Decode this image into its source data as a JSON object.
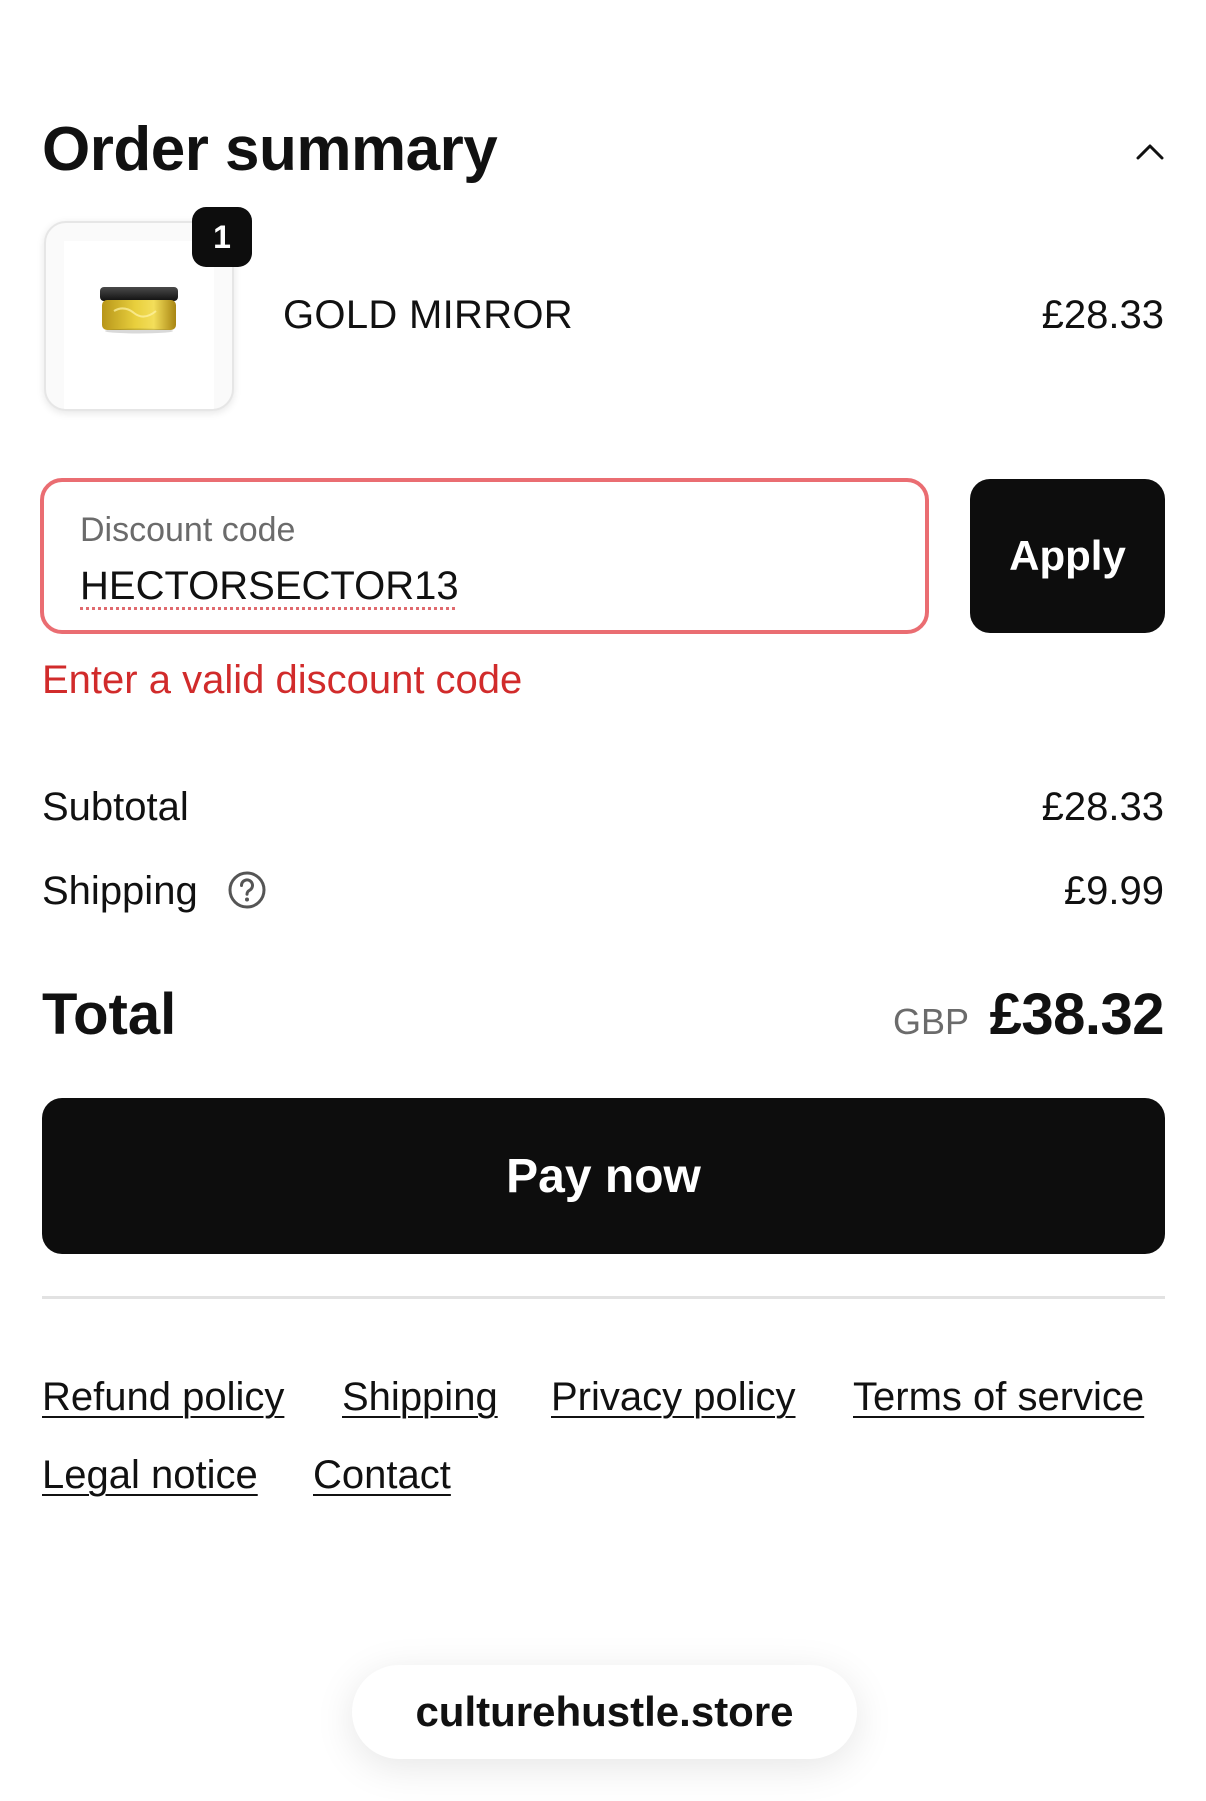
{
  "header": {
    "title": "Order summary",
    "toggle_icon": "chevron-up-icon"
  },
  "product": {
    "quantity": "1",
    "name": "GOLD MIRROR",
    "price": "£28.33",
    "image_icon": "gold-jar-image"
  },
  "discount": {
    "label": "Discount code",
    "value": "HECTORSECTOR13",
    "apply_label": "Apply",
    "error": "Enter a valid discount code",
    "error_color": "#d12b2b",
    "border_color": "#ea6d72"
  },
  "summary": {
    "subtotal_label": "Subtotal",
    "subtotal_value": "£28.33",
    "shipping_label": "Shipping",
    "shipping_help_icon": "question-circle-icon",
    "shipping_value": "£9.99",
    "total_label": "Total",
    "total_currency": "GBP",
    "total_value": "£38.32"
  },
  "pay_button": {
    "label": "Pay now"
  },
  "footer": {
    "links": [
      "Refund policy",
      "Shipping",
      "Privacy policy",
      "Terms of service",
      "Legal notice",
      "Contact"
    ]
  },
  "domain": "culturehustle.store"
}
